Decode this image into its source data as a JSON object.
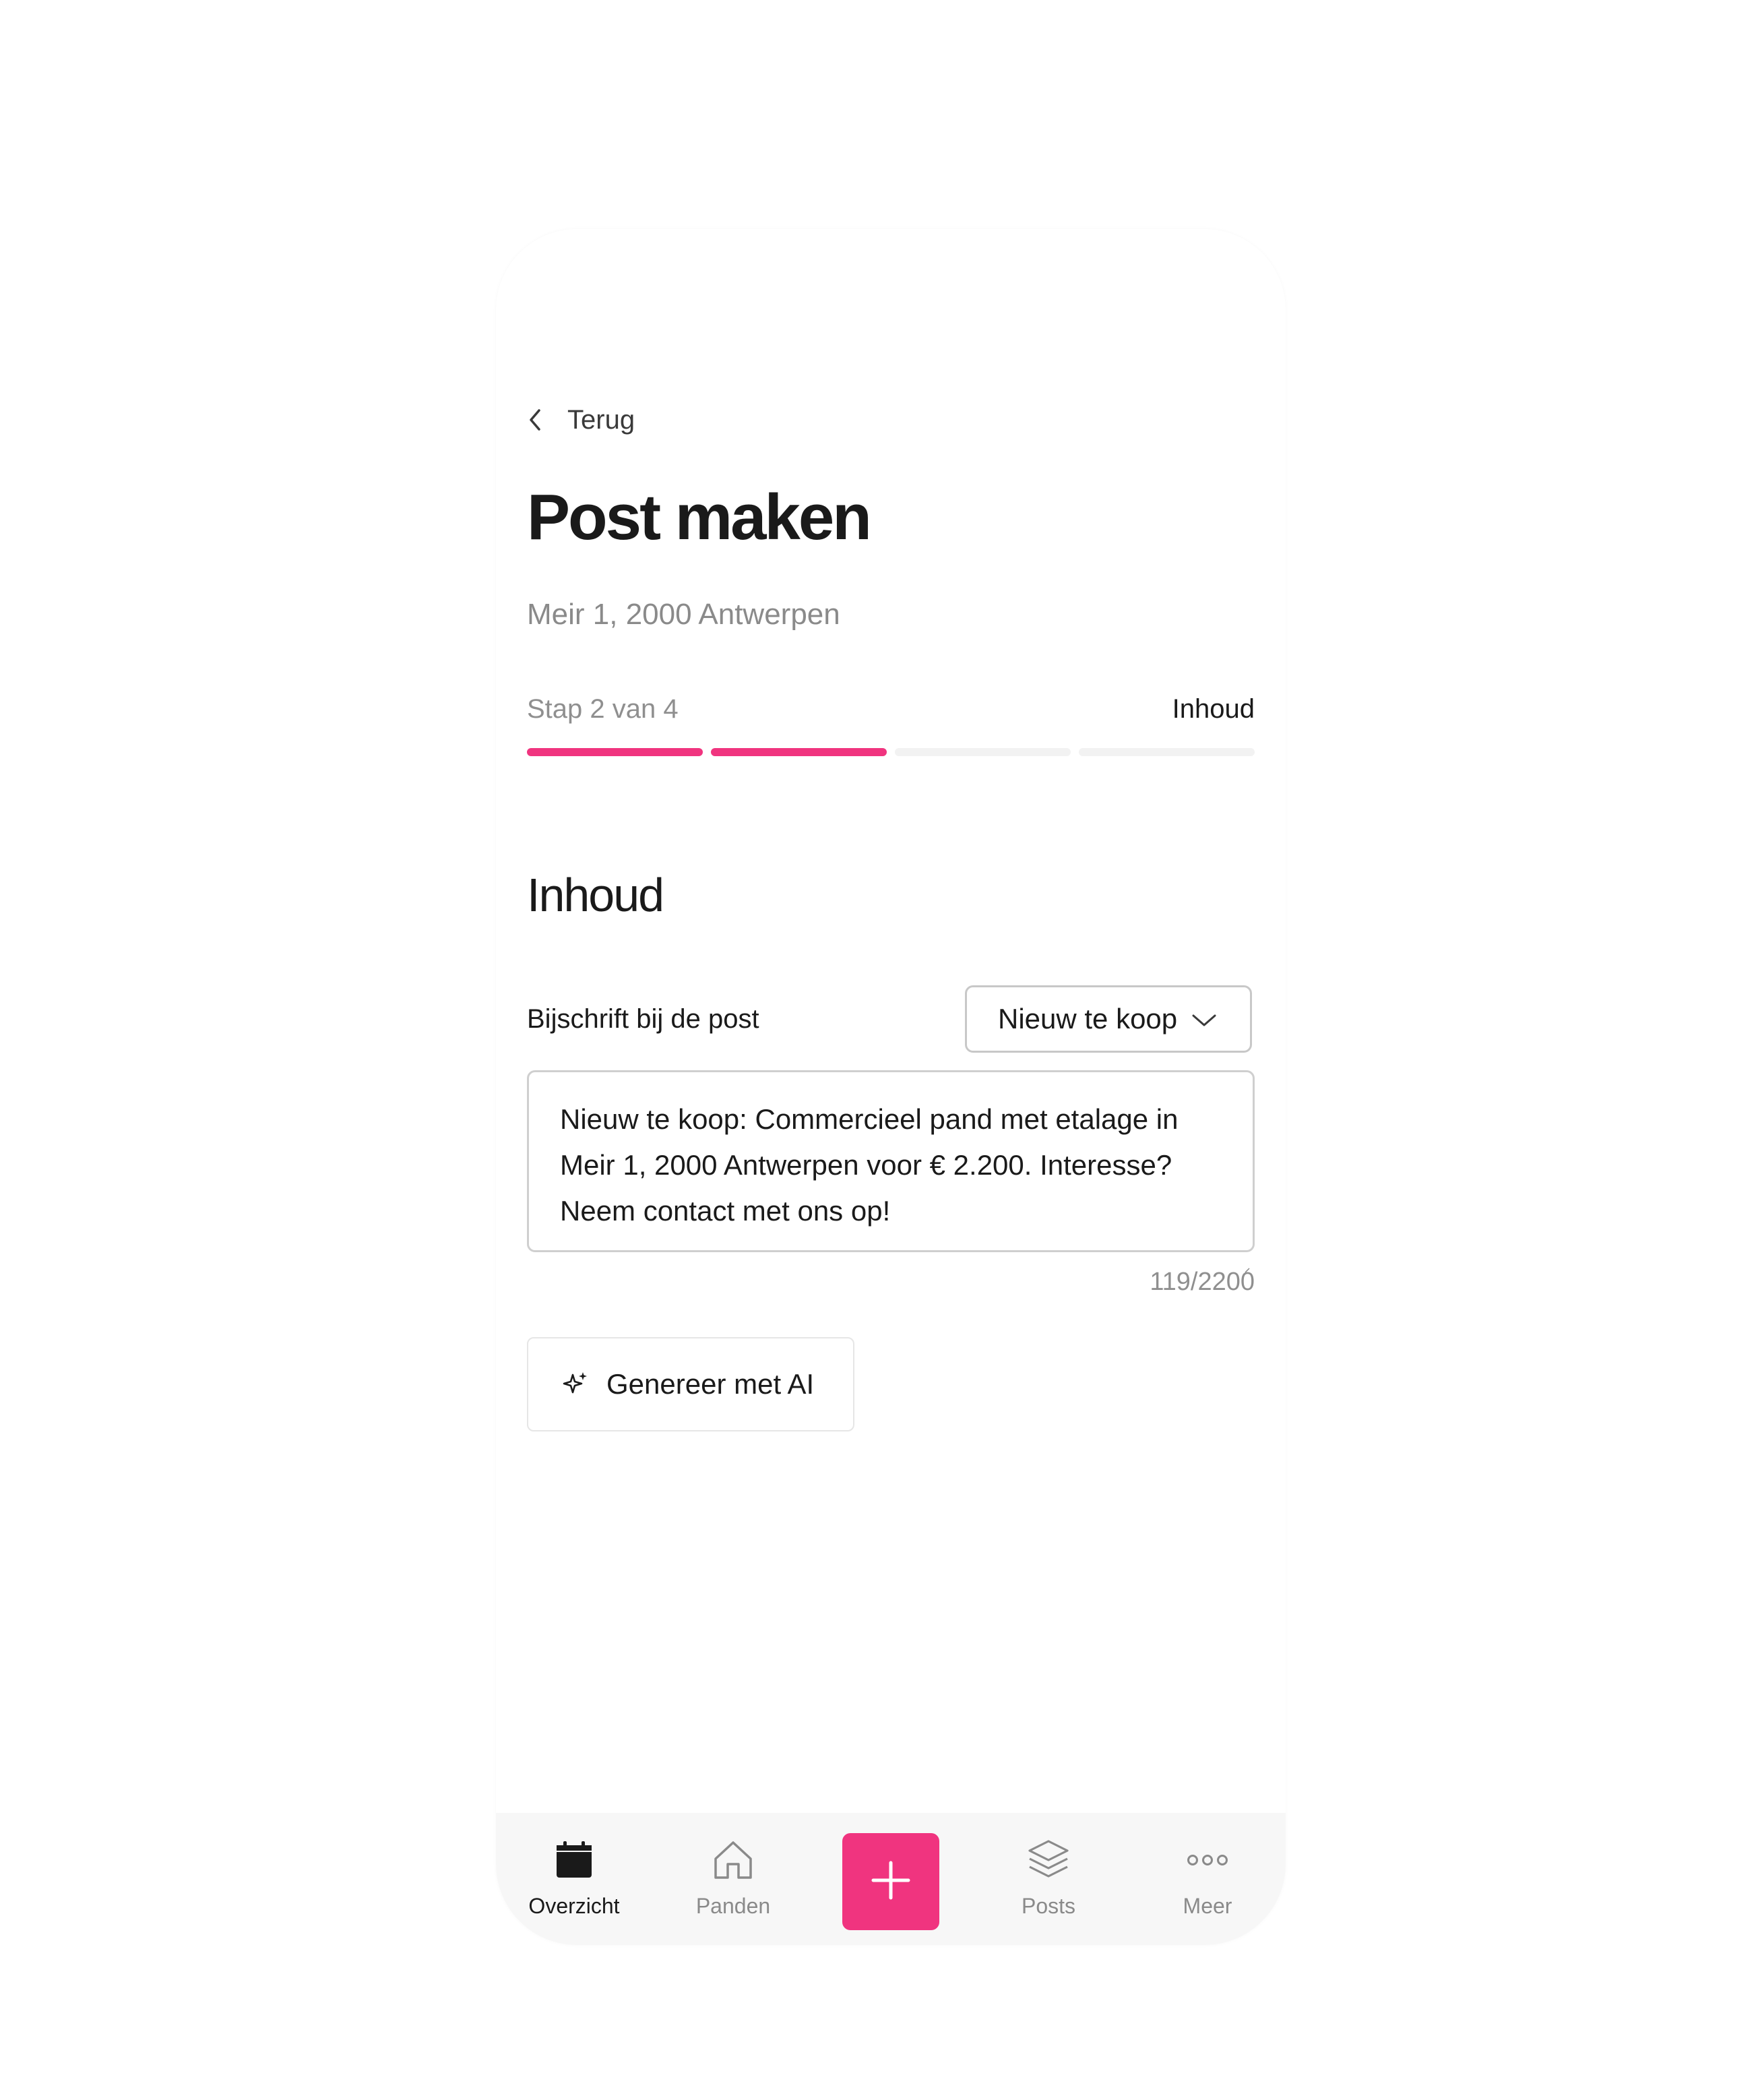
{
  "header": {
    "back_label": "Terug",
    "title": "Post maken",
    "address": "Meir 1, 2000 Antwerpen"
  },
  "progress": {
    "step_label": "Stap 2 van 4",
    "step_name": "Inhoud",
    "current": 2,
    "total": 4
  },
  "section": {
    "title": "Inhoud"
  },
  "caption": {
    "label": "Bijschrift bij de post",
    "template_selected": "Nieuw te koop",
    "text": "Nieuw te koop: Commercieel pand met etalage in Meir 1, 2000 Antwerpen voor € 2.200. Interesse? Neem contact met ons op!",
    "counter": "119/2200"
  },
  "ai_button": {
    "label": "Genereer met AI",
    "icon": "sparkle-icon"
  },
  "tabbar": {
    "items": [
      {
        "label": "Overzicht",
        "icon": "calendar-icon",
        "active": true
      },
      {
        "label": "Panden",
        "icon": "home-icon",
        "active": false
      },
      {
        "label": "Posts",
        "icon": "layers-icon",
        "active": false
      },
      {
        "label": "Meer",
        "icon": "more-icon",
        "active": false
      }
    ],
    "fab_icon": "plus-icon"
  },
  "colors": {
    "accent": "#f0347f",
    "text": "#1a1a1a",
    "muted": "#8a8a8a",
    "track": "#f2f2f2"
  }
}
